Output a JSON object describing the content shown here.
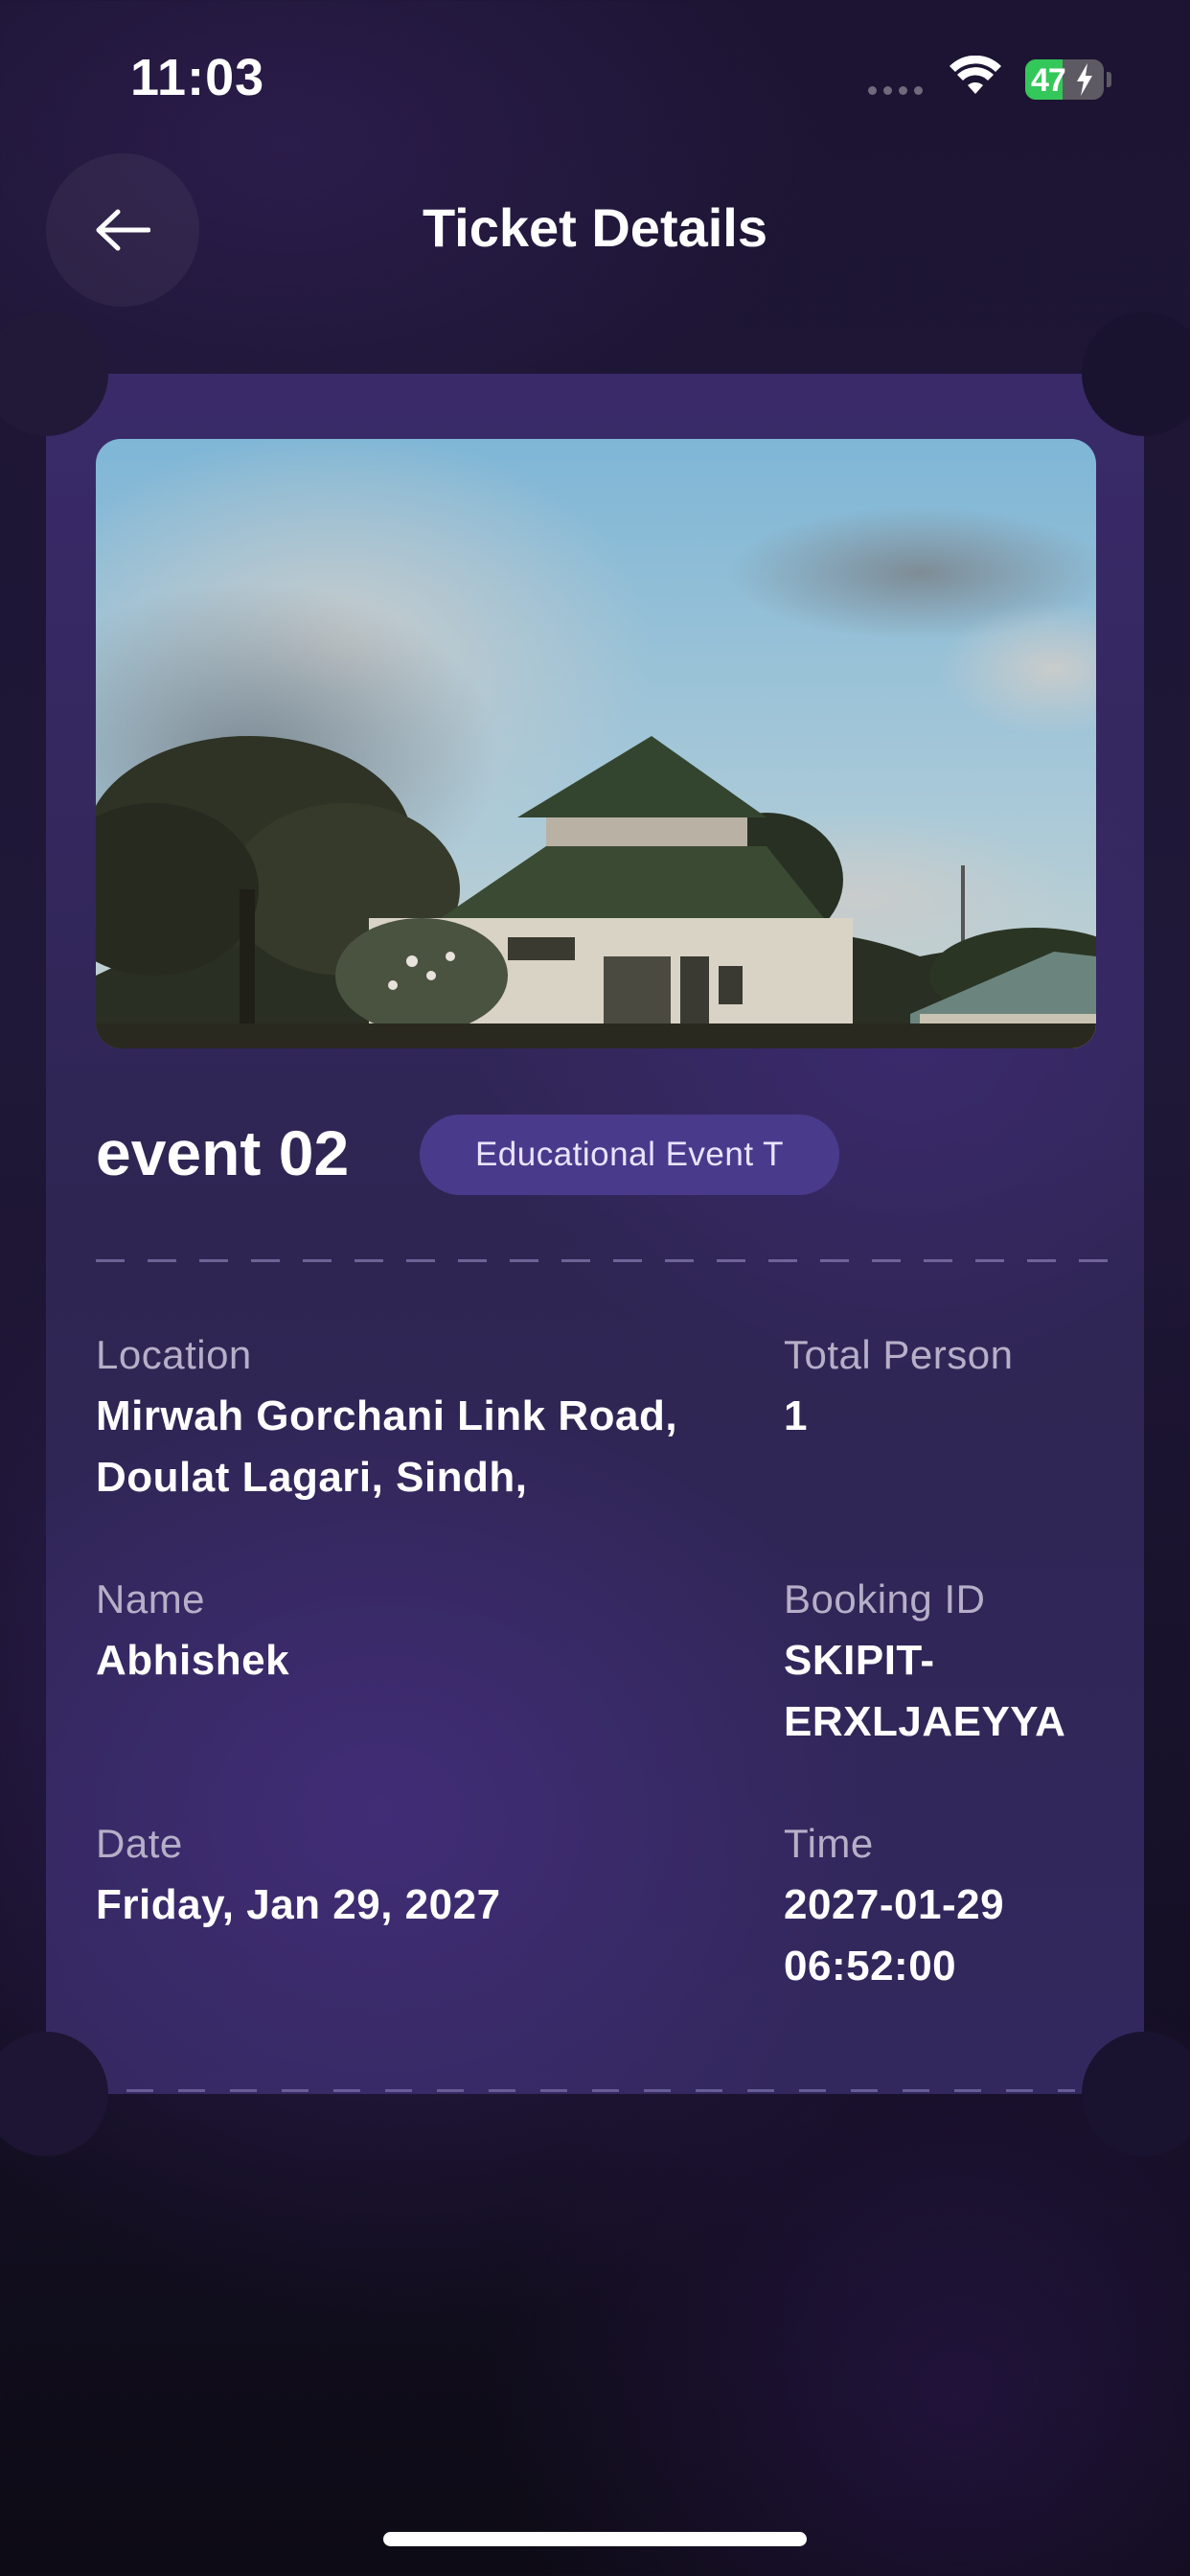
{
  "status_bar": {
    "time": "11:03",
    "battery_level": "47",
    "battery_percent": 47,
    "icons": [
      "cellular-signal-icon",
      "wifi-icon",
      "battery-charging-icon"
    ]
  },
  "header": {
    "title": "Ticket Details",
    "back_icon": "arrow-left-icon"
  },
  "ticket": {
    "image": "event-photo",
    "event_name": "event 02",
    "category": "Educational Event T",
    "fields": {
      "location": {
        "label": "Location",
        "value": "Mirwah Gorchani Link Road, Doulat Lagari, Sindh,"
      },
      "total_person": {
        "label": "Total Person",
        "value": "1"
      },
      "name": {
        "label": "Name",
        "value": "Abhishek"
      },
      "booking_id": {
        "label": "Booking ID",
        "value": "SKIPIT-ERXLJAEYYA"
      },
      "date": {
        "label": "Date",
        "value": "Friday, Jan 29, 2027"
      },
      "time": {
        "label": "Time",
        "value": "2027-01-29 06:52:00"
      }
    }
  },
  "colors": {
    "accent_badge": "#4a3a8c",
    "ticket_background": "#2e2552",
    "battery_green": "#34c759"
  }
}
